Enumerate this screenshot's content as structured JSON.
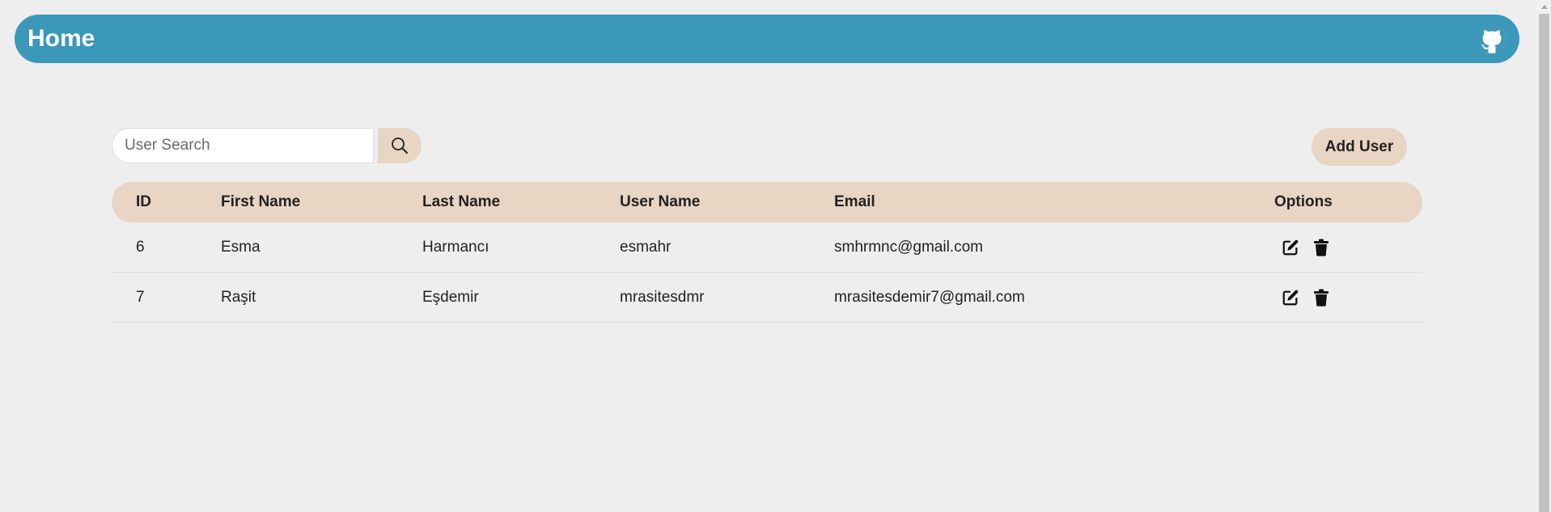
{
  "header": {
    "title": "Home",
    "github_icon": "github-icon",
    "color": "#3b98b9"
  },
  "search": {
    "placeholder": "User Search",
    "value": "",
    "icon": "search-icon"
  },
  "actions": {
    "add_user_label": "Add User"
  },
  "table": {
    "columns": [
      "ID",
      "First Name",
      "Last Name",
      "User Name",
      "Email",
      "Options"
    ],
    "rows": [
      {
        "id": "6",
        "first_name": "Esma",
        "last_name": "Harmancı",
        "user_name": "esmahr",
        "email": "smhrmnc@gmail.com"
      },
      {
        "id": "7",
        "first_name": "Raşit",
        "last_name": "Eşdemir",
        "user_name": "mrasitesdmr",
        "email": "mrasitesdemir7@gmail.com"
      }
    ],
    "row_icons": [
      "edit-icon",
      "trash-icon"
    ],
    "header_color": "#e8d5c4"
  }
}
